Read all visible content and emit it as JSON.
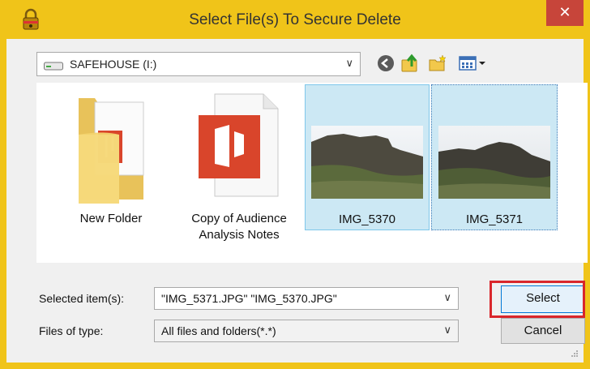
{
  "window": {
    "title": "Select File(s) To Secure Delete",
    "close_glyph": "✕"
  },
  "toolbar": {
    "drive": {
      "label": "SAFEHOUSE (I:)",
      "icon": "drive-icon"
    },
    "icons": [
      "back-icon",
      "up-folder-icon",
      "new-folder-icon",
      "view-menu-icon"
    ]
  },
  "files": [
    {
      "name": "New Folder",
      "type": "folder",
      "selected": false
    },
    {
      "name": "Copy of Audience Analysis  Notes",
      "type": "document",
      "selected": false
    },
    {
      "name": "IMG_5370",
      "type": "image",
      "selected": true
    },
    {
      "name": "IMG_5371",
      "type": "image",
      "selected": true
    }
  ],
  "form": {
    "selected_label": "Selected item(s):",
    "selected_value": "\"IMG_5371.JPG\" \"IMG_5370.JPG\"",
    "type_label": "Files of type:",
    "type_value": "All files and folders(*.*)"
  },
  "buttons": {
    "select": "Select",
    "cancel": "Cancel"
  },
  "colors": {
    "titlebar": "#f0c419",
    "selection": "#cce8f4",
    "highlight": "#d9262b",
    "office_red": "#d9452b"
  }
}
